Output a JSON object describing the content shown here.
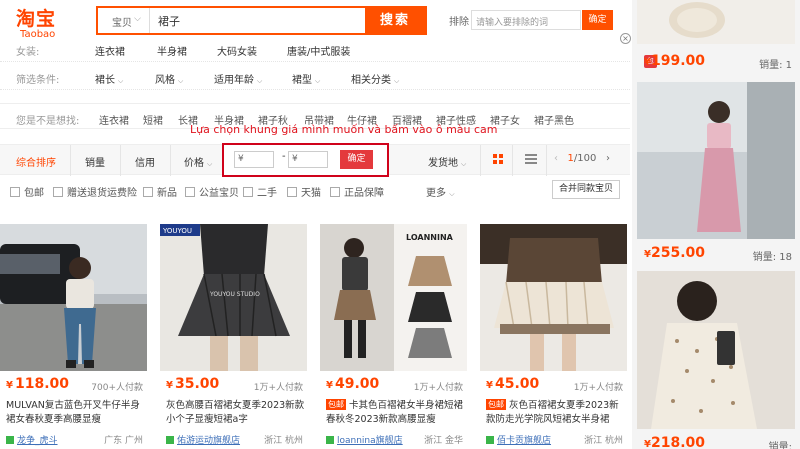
{
  "logo": {
    "cn": "淘宝",
    "en": "Taobao"
  },
  "search": {
    "type": "宝贝",
    "query": "裙子",
    "button": "搜索"
  },
  "exclude": {
    "label": "排除",
    "placeholder": "请输入要排除的词",
    "button": "确定"
  },
  "filters": {
    "row1": {
      "label": "女装:",
      "items": [
        "连衣裙",
        "半身裙",
        "大码女装",
        "唐装/中式服装"
      ]
    },
    "row2": {
      "label": "筛选条件:",
      "items": [
        "裙长",
        "风格",
        "适用年龄",
        "裙型",
        "相关分类"
      ]
    }
  },
  "suggest": {
    "label": "您是不是想找:",
    "items": [
      "连衣裙",
      "短裙",
      "长裙",
      "半身裙",
      "裙子秋",
      "吊带裙",
      "牛仔裙",
      "百褶裙",
      "裙子性感",
      "裙子女",
      "裙子黑色"
    ]
  },
  "annotation": "Lựa chọn khung giá mình muốn và bấm vào ô màu cam",
  "sort": {
    "items": [
      "综合排序",
      "销量",
      "信用",
      "价格"
    ],
    "price_from": "¥",
    "price_to": "¥",
    "price_dash": "-",
    "price_button": "确定",
    "origin": "发货地",
    "page": "1",
    "total_pages": "/100"
  },
  "checks": [
    "包邮",
    "赠送退货运费险",
    "新品",
    "公益宝贝",
    "二手",
    "天猫",
    "正品保障"
  ],
  "more": "更多",
  "merge": "合并同款宝贝",
  "products": [
    {
      "price": "118.00",
      "sold": "700+人付款",
      "tag": "",
      "title": "MULVAN复古蓝色开叉牛仔半身裙女春秋夏季高腰显瘦",
      "shop": "龙争_虎斗",
      "loc": "广东 广州"
    },
    {
      "price": "35.00",
      "sold": "1万+人付款",
      "tag": "",
      "title": "灰色高腰百褶裙女夏季2023新款小个子显瘦短裙a字",
      "shop": "佑游运动旗舰店",
      "loc": "浙江 杭州"
    },
    {
      "price": "49.00",
      "sold": "1万+人付款",
      "tag": "包邮",
      "title": "卡其色百褶裙女半身裙短裙春秋冬2023新款高腰显瘦",
      "shop": "loannina旗舰店",
      "loc": "浙江 金华"
    },
    {
      "price": "45.00",
      "sold": "1万+人付款",
      "tag": "包邮",
      "title": "灰色百褶裙女夏季2023新款防走光学院风短裙女半身裙",
      "shop": "佰卡贡旗舰店",
      "loc": "浙江 杭州"
    }
  ],
  "right_col": [
    {
      "price": "199.00",
      "sold": "销量: 1",
      "badge": "包"
    },
    {
      "price": "255.00",
      "sold": "销量: 18"
    },
    {
      "price": "218.00",
      "sold": "销量:"
    }
  ],
  "youyou": {
    "brand": "YOUYOU",
    "studio": "YOUYOU STUDIO"
  },
  "loannina": {
    "brand": "LOANNINA"
  }
}
